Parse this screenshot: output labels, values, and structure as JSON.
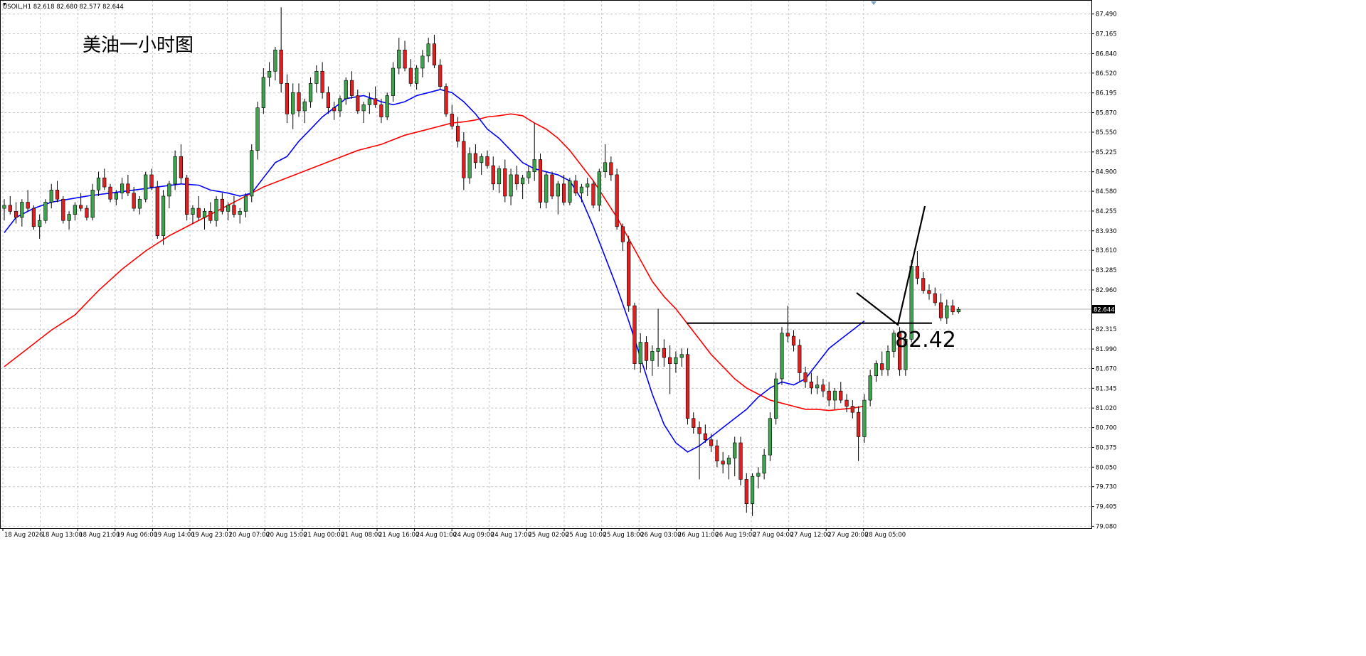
{
  "header": {
    "symbol_info": "USOIL,H1  82.618 82.680 82.577 82.644"
  },
  "chart_data": {
    "type": "candlestick",
    "title": "美油一小时图",
    "timeframe": "H1",
    "ylim": [
      79.05,
      87.72
    ],
    "grid": true,
    "y_ticks": [
      "87.490",
      "87.165",
      "86.840",
      "86.520",
      "86.195",
      "85.870",
      "85.550",
      "85.225",
      "84.900",
      "84.580",
      "84.255",
      "83.930",
      "83.610",
      "83.285",
      "82.960",
      "82.315",
      "81.990",
      "81.670",
      "81.345",
      "81.020",
      "80.700",
      "80.375",
      "80.050",
      "79.730",
      "79.405",
      "79.080"
    ],
    "x_ticks": [
      "18 Aug 2026",
      "18 Aug 13:00",
      "18 Aug 21:00",
      "19 Aug 06:00",
      "19 Aug 14:00",
      "19 Aug 23:01",
      "20 Aug 07:00",
      "20 Aug 15:00",
      "21 Aug 00:00",
      "21 Aug 08:00",
      "21 Aug 16:00",
      "24 Aug 01:00",
      "24 Aug 09:00",
      "24 Aug 17:00",
      "25 Aug 02:00",
      "25 Aug 10:00",
      "25 Aug 18:00",
      "26 Aug 03:00",
      "26 Aug 11:00",
      "26 Aug 19:00",
      "27 Aug 04:00",
      "27 Aug 12:00",
      "27 Aug 20:00",
      "28 Aug 05:00"
    ],
    "current_price": "82.644",
    "support_level": 82.42,
    "support_label": "82.42",
    "colors": {
      "up": "#3fa34d",
      "down": "#e02020",
      "wick": "#000000",
      "ma_fast": "#0000ff",
      "ma_slow": "#ff0000",
      "grid": "#c8c8c8",
      "annotation": "#000000"
    },
    "ma_fast": [
      [
        0,
        83.9
      ],
      [
        2,
        84.15
      ],
      [
        5,
        84.3
      ],
      [
        8,
        84.4
      ],
      [
        11,
        84.45
      ],
      [
        14,
        84.5
      ],
      [
        18,
        84.55
      ],
      [
        22,
        84.6
      ],
      [
        26,
        84.65
      ],
      [
        30,
        84.7
      ],
      [
        33,
        84.68
      ],
      [
        35,
        84.6
      ],
      [
        38,
        84.55
      ],
      [
        40,
        84.5
      ],
      [
        42,
        84.55
      ],
      [
        44,
        84.8
      ],
      [
        46,
        85.05
      ],
      [
        48,
        85.15
      ],
      [
        50,
        85.4
      ],
      [
        52,
        85.6
      ],
      [
        54,
        85.8
      ],
      [
        56,
        85.95
      ],
      [
        58,
        86.1
      ],
      [
        61,
        86.15
      ],
      [
        64,
        86.05
      ],
      [
        66,
        86.0
      ],
      [
        68,
        86.05
      ],
      [
        70,
        86.15
      ],
      [
        72,
        86.2
      ],
      [
        74,
        86.25
      ],
      [
        76,
        86.2
      ],
      [
        78,
        86.05
      ],
      [
        80,
        85.85
      ],
      [
        82,
        85.6
      ],
      [
        84,
        85.45
      ],
      [
        86,
        85.25
      ],
      [
        88,
        85.05
      ],
      [
        90,
        84.95
      ],
      [
        92,
        84.9
      ],
      [
        94,
        84.85
      ],
      [
        96,
        84.75
      ],
      [
        98,
        84.45
      ],
      [
        100,
        84.0
      ],
      [
        102,
        83.5
      ],
      [
        104,
        83.0
      ],
      [
        106,
        82.45
      ],
      [
        108,
        81.85
      ],
      [
        110,
        81.25
      ],
      [
        112,
        80.75
      ],
      [
        114,
        80.45
      ],
      [
        116,
        80.3
      ],
      [
        118,
        80.4
      ],
      [
        120,
        80.55
      ],
      [
        122,
        80.7
      ],
      [
        124,
        80.85
      ],
      [
        126,
        81.0
      ],
      [
        128,
        81.2
      ],
      [
        130,
        81.35
      ],
      [
        132,
        81.45
      ],
      [
        134,
        81.4
      ],
      [
        136,
        81.5
      ],
      [
        138,
        81.75
      ],
      [
        140,
        82.0
      ],
      [
        142,
        82.15
      ],
      [
        144,
        82.3
      ],
      [
        146,
        82.45
      ]
    ],
    "ma_slow": [
      [
        0,
        81.7
      ],
      [
        4,
        82.0
      ],
      [
        8,
        82.3
      ],
      [
        12,
        82.55
      ],
      [
        16,
        82.95
      ],
      [
        20,
        83.3
      ],
      [
        24,
        83.6
      ],
      [
        28,
        83.85
      ],
      [
        32,
        84.05
      ],
      [
        36,
        84.25
      ],
      [
        40,
        84.45
      ],
      [
        44,
        84.65
      ],
      [
        48,
        84.8
      ],
      [
        52,
        84.95
      ],
      [
        56,
        85.1
      ],
      [
        60,
        85.25
      ],
      [
        64,
        85.35
      ],
      [
        68,
        85.5
      ],
      [
        72,
        85.6
      ],
      [
        74,
        85.65
      ],
      [
        76,
        85.7
      ],
      [
        78,
        85.72
      ],
      [
        80,
        85.75
      ],
      [
        82,
        85.8
      ],
      [
        84,
        85.82
      ],
      [
        86,
        85.85
      ],
      [
        88,
        85.82
      ],
      [
        90,
        85.7
      ],
      [
        92,
        85.6
      ],
      [
        94,
        85.45
      ],
      [
        96,
        85.25
      ],
      [
        98,
        85.0
      ],
      [
        100,
        84.75
      ],
      [
        102,
        84.45
      ],
      [
        104,
        84.15
      ],
      [
        106,
        83.8
      ],
      [
        108,
        83.45
      ],
      [
        110,
        83.1
      ],
      [
        112,
        82.85
      ],
      [
        114,
        82.65
      ],
      [
        116,
        82.4
      ],
      [
        118,
        82.15
      ],
      [
        120,
        81.9
      ],
      [
        122,
        81.7
      ],
      [
        124,
        81.5
      ],
      [
        126,
        81.35
      ],
      [
        128,
        81.25
      ],
      [
        130,
        81.15
      ],
      [
        132,
        81.1
      ],
      [
        134,
        81.05
      ],
      [
        136,
        81.0
      ],
      [
        138,
        81.0
      ],
      [
        140,
        80.98
      ],
      [
        142,
        81.0
      ],
      [
        144,
        81.02
      ],
      [
        146,
        81.05
      ]
    ],
    "candles": [
      [
        84.3,
        84.45,
        84.1,
        84.35
      ],
      [
        84.35,
        84.5,
        84.2,
        84.25
      ],
      [
        84.25,
        84.4,
        84.05,
        84.15
      ],
      [
        84.15,
        84.45,
        84.0,
        84.4
      ],
      [
        84.4,
        84.6,
        84.25,
        84.3
      ],
      [
        84.3,
        84.35,
        83.95,
        84.0
      ],
      [
        84.0,
        84.2,
        83.8,
        84.1
      ],
      [
        84.1,
        84.45,
        84.05,
        84.4
      ],
      [
        84.4,
        84.7,
        84.3,
        84.6
      ],
      [
        84.6,
        84.75,
        84.4,
        84.45
      ],
      [
        84.45,
        84.5,
        84.05,
        84.1
      ],
      [
        84.1,
        84.25,
        83.95,
        84.2
      ],
      [
        84.2,
        84.4,
        84.1,
        84.35
      ],
      [
        84.35,
        84.55,
        84.25,
        84.3
      ],
      [
        84.3,
        84.35,
        84.1,
        84.15
      ],
      [
        84.15,
        84.7,
        84.1,
        84.6
      ],
      [
        84.6,
        84.9,
        84.5,
        84.8
      ],
      [
        84.8,
        84.95,
        84.6,
        84.65
      ],
      [
        84.65,
        84.7,
        84.4,
        84.45
      ],
      [
        84.45,
        84.6,
        84.35,
        84.55
      ],
      [
        84.55,
        84.8,
        84.45,
        84.7
      ],
      [
        84.7,
        84.85,
        84.5,
        84.55
      ],
      [
        84.55,
        84.65,
        84.25,
        84.3
      ],
      [
        84.3,
        84.5,
        84.2,
        84.45
      ],
      [
        84.45,
        84.9,
        84.4,
        84.85
      ],
      [
        84.85,
        84.95,
        84.6,
        84.65
      ],
      [
        84.65,
        84.75,
        83.8,
        83.85
      ],
      [
        83.85,
        84.6,
        83.7,
        84.5
      ],
      [
        84.5,
        84.75,
        84.3,
        84.7
      ],
      [
        84.7,
        85.25,
        84.6,
        85.15
      ],
      [
        85.15,
        85.35,
        84.7,
        84.8
      ],
      [
        84.8,
        84.85,
        84.1,
        84.2
      ],
      [
        84.2,
        84.35,
        84.05,
        84.3
      ],
      [
        84.3,
        84.5,
        84.1,
        84.15
      ],
      [
        84.15,
        84.3,
        83.95,
        84.25
      ],
      [
        84.25,
        84.4,
        84.05,
        84.1
      ],
      [
        84.1,
        84.5,
        84.0,
        84.45
      ],
      [
        84.45,
        84.55,
        84.2,
        84.25
      ],
      [
        84.25,
        84.4,
        84.1,
        84.35
      ],
      [
        84.35,
        84.5,
        84.15,
        84.2
      ],
      [
        84.2,
        84.3,
        84.05,
        84.25
      ],
      [
        84.25,
        84.55,
        84.15,
        84.5
      ],
      [
        84.5,
        85.35,
        84.4,
        85.25
      ],
      [
        85.25,
        86.05,
        85.1,
        85.95
      ],
      [
        85.95,
        86.6,
        85.85,
        86.45
      ],
      [
        86.45,
        86.7,
        86.3,
        86.55
      ],
      [
        86.55,
        86.95,
        86.4,
        86.9
      ],
      [
        86.9,
        87.6,
        86.2,
        86.35
      ],
      [
        86.35,
        86.5,
        85.7,
        85.85
      ],
      [
        85.85,
        86.35,
        85.6,
        86.2
      ],
      [
        86.2,
        86.35,
        85.8,
        85.9
      ],
      [
        85.9,
        86.1,
        85.7,
        86.05
      ],
      [
        86.05,
        86.45,
        85.95,
        86.35
      ],
      [
        86.35,
        86.65,
        86.2,
        86.55
      ],
      [
        86.55,
        86.7,
        86.1,
        86.2
      ],
      [
        86.2,
        86.3,
        85.85,
        85.95
      ],
      [
        85.95,
        86.05,
        85.75,
        85.9
      ],
      [
        85.9,
        86.15,
        85.8,
        86.1
      ],
      [
        86.1,
        86.45,
        86.0,
        86.4
      ],
      [
        86.4,
        86.55,
        86.1,
        86.15
      ],
      [
        86.15,
        86.25,
        85.85,
        85.9
      ],
      [
        85.9,
        86.05,
        85.7,
        86.0
      ],
      [
        86.0,
        86.2,
        85.85,
        86.1
      ],
      [
        86.1,
        86.3,
        85.95,
        86.0
      ],
      [
        86.0,
        86.1,
        85.7,
        85.8
      ],
      [
        85.8,
        86.2,
        85.75,
        86.15
      ],
      [
        86.15,
        86.7,
        86.05,
        86.6
      ],
      [
        86.6,
        87.1,
        86.5,
        86.9
      ],
      [
        86.9,
        87.05,
        86.55,
        86.6
      ],
      [
        86.6,
        86.75,
        86.3,
        86.35
      ],
      [
        86.35,
        86.65,
        86.25,
        86.6
      ],
      [
        86.6,
        86.9,
        86.45,
        86.8
      ],
      [
        86.8,
        87.1,
        86.7,
        87.0
      ],
      [
        87.0,
        87.15,
        86.6,
        86.65
      ],
      [
        86.65,
        86.75,
        86.25,
        86.3
      ],
      [
        86.3,
        86.35,
        85.8,
        85.85
      ],
      [
        85.85,
        86.0,
        85.6,
        85.65
      ],
      [
        85.65,
        85.8,
        85.3,
        85.4
      ],
      [
        85.4,
        85.55,
        84.6,
        84.8
      ],
      [
        84.8,
        85.3,
        84.7,
        85.2
      ],
      [
        85.2,
        85.35,
        84.95,
        85.05
      ],
      [
        85.05,
        85.2,
        84.85,
        85.15
      ],
      [
        85.15,
        85.25,
        84.95,
        85.0
      ],
      [
        85.0,
        85.15,
        84.6,
        84.7
      ],
      [
        84.7,
        85.0,
        84.55,
        84.95
      ],
      [
        84.95,
        85.1,
        84.4,
        84.5
      ],
      [
        84.5,
        84.95,
        84.35,
        84.85
      ],
      [
        84.85,
        85.0,
        84.6,
        84.7
      ],
      [
        84.7,
        84.85,
        84.45,
        84.8
      ],
      [
        84.8,
        85.0,
        84.7,
        84.9
      ],
      [
        84.9,
        85.7,
        84.75,
        85.1
      ],
      [
        85.1,
        85.2,
        84.3,
        84.4
      ],
      [
        84.4,
        84.9,
        84.3,
        84.85
      ],
      [
        84.85,
        84.9,
        84.45,
        84.5
      ],
      [
        84.5,
        84.75,
        84.2,
        84.7
      ],
      [
        84.7,
        84.85,
        84.35,
        84.4
      ],
      [
        84.4,
        84.8,
        84.35,
        84.75
      ],
      [
        84.75,
        84.85,
        84.5,
        84.55
      ],
      [
        84.55,
        84.7,
        84.4,
        84.65
      ],
      [
        84.65,
        84.8,
        84.5,
        84.7
      ],
      [
        84.7,
        84.75,
        84.3,
        84.35
      ],
      [
        84.35,
        84.95,
        84.25,
        84.9
      ],
      [
        84.9,
        85.35,
        84.8,
        85.05
      ],
      [
        85.05,
        85.15,
        84.75,
        84.85
      ],
      [
        84.85,
        84.95,
        83.95,
        84.0
      ],
      [
        84.0,
        84.05,
        83.6,
        83.75
      ],
      [
        83.75,
        83.85,
        82.6,
        82.7
      ],
      [
        82.7,
        82.75,
        81.65,
        81.75
      ],
      [
        81.75,
        82.25,
        81.6,
        82.1
      ],
      [
        82.1,
        82.2,
        81.65,
        81.8
      ],
      [
        81.8,
        82.05,
        81.55,
        81.95
      ],
      [
        81.95,
        82.65,
        81.7,
        82.0
      ],
      [
        82.0,
        82.15,
        81.7,
        81.85
      ],
      [
        81.85,
        82.05,
        81.25,
        81.75
      ],
      [
        81.75,
        81.95,
        81.6,
        81.85
      ],
      [
        81.85,
        82.0,
        81.7,
        81.9
      ],
      [
        81.9,
        82.0,
        80.75,
        80.85
      ],
      [
        80.85,
        80.95,
        80.6,
        80.7
      ],
      [
        80.7,
        80.8,
        79.85,
        80.6
      ],
      [
        80.6,
        80.75,
        80.45,
        80.5
      ],
      [
        80.5,
        80.6,
        80.3,
        80.4
      ],
      [
        80.4,
        80.5,
        80.05,
        80.15
      ],
      [
        80.15,
        80.3,
        79.95,
        80.1
      ],
      [
        80.1,
        80.25,
        79.85,
        80.2
      ],
      [
        80.2,
        80.55,
        79.9,
        80.45
      ],
      [
        80.45,
        80.55,
        79.75,
        79.85
      ],
      [
        79.85,
        79.95,
        79.3,
        79.45
      ],
      [
        79.45,
        79.95,
        79.25,
        79.9
      ],
      [
        79.9,
        80.05,
        79.7,
        79.95
      ],
      [
        79.95,
        80.35,
        79.85,
        80.25
      ],
      [
        80.25,
        80.95,
        80.15,
        80.85
      ],
      [
        80.85,
        81.6,
        80.75,
        81.5
      ],
      [
        81.5,
        82.35,
        81.4,
        82.25
      ],
      [
        82.25,
        82.7,
        82.1,
        82.2
      ],
      [
        82.2,
        82.3,
        81.95,
        82.05
      ],
      [
        82.05,
        82.15,
        81.45,
        81.6
      ],
      [
        81.6,
        81.7,
        81.35,
        81.45
      ],
      [
        81.45,
        81.6,
        81.25,
        81.35
      ],
      [
        81.35,
        81.55,
        81.25,
        81.4
      ],
      [
        81.4,
        81.5,
        81.2,
        81.3
      ],
      [
        81.3,
        81.45,
        81.05,
        81.15
      ],
      [
        81.15,
        81.35,
        81.0,
        81.3
      ],
      [
        81.3,
        81.45,
        81.1,
        81.15
      ],
      [
        81.15,
        81.25,
        80.95,
        81.05
      ],
      [
        81.05,
        81.15,
        80.85,
        80.95
      ],
      [
        80.95,
        81.05,
        80.15,
        80.55
      ],
      [
        80.55,
        81.25,
        80.45,
        81.15
      ],
      [
        81.15,
        81.65,
        81.05,
        81.55
      ],
      [
        81.55,
        81.8,
        81.45,
        81.75
      ],
      [
        81.75,
        81.95,
        81.55,
        81.65
      ],
      [
        81.65,
        82.05,
        81.55,
        81.95
      ],
      [
        81.95,
        82.3,
        81.85,
        82.25
      ],
      [
        82.25,
        82.35,
        81.55,
        81.65
      ],
      [
        81.65,
        82.25,
        81.55,
        82.15
      ],
      [
        82.15,
        83.45,
        82.1,
        83.35
      ],
      [
        83.35,
        83.6,
        83.05,
        83.15
      ],
      [
        83.15,
        83.25,
        82.9,
        82.95
      ],
      [
        82.95,
        83.05,
        82.8,
        82.9
      ],
      [
        82.9,
        83.0,
        82.7,
        82.75
      ],
      [
        82.75,
        82.9,
        82.45,
        82.5
      ],
      [
        82.5,
        82.8,
        82.4,
        82.7
      ],
      [
        82.7,
        82.8,
        82.55,
        82.6
      ],
      [
        82.6,
        82.68,
        82.57,
        82.64
      ]
    ],
    "annotation_path": [
      [
        1204,
        412
      ],
      [
        1262,
        457
      ],
      [
        1300,
        290
      ]
    ]
  }
}
